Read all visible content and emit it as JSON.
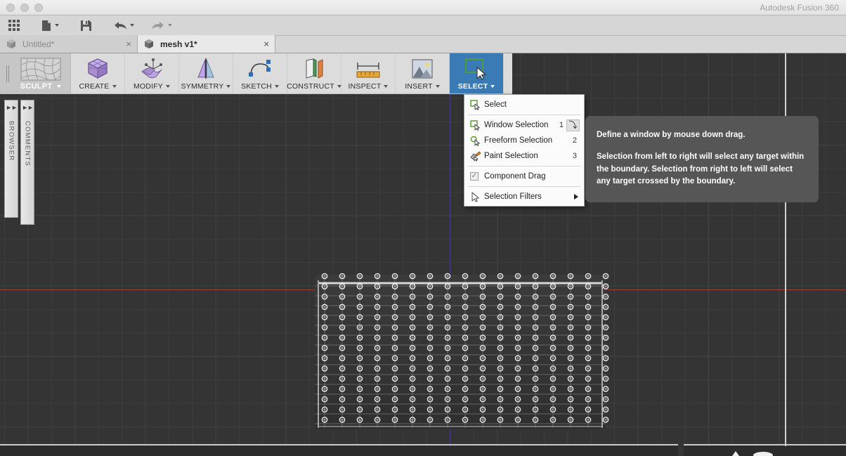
{
  "window": {
    "app_title": "Autodesk Fusion 360",
    "traffic_lights": [
      "close",
      "minimize",
      "zoom"
    ]
  },
  "quick_access": {
    "items": [
      {
        "name": "app-grid",
        "icon": "grid-icon",
        "has_caret": false
      },
      {
        "name": "new-file",
        "icon": "file-icon",
        "has_caret": true
      },
      {
        "name": "save",
        "icon": "save-icon",
        "has_caret": false
      },
      {
        "name": "undo",
        "icon": "undo-arrow-icon",
        "has_caret": true
      },
      {
        "name": "redo",
        "icon": "redo-arrow-icon",
        "has_caret": true
      }
    ]
  },
  "document_tabs": [
    {
      "label": "Untitled*",
      "active": false,
      "icon": "cube-icon",
      "close": "×"
    },
    {
      "label": "mesh v1*",
      "active": true,
      "icon": "cube-icon",
      "close": "×"
    }
  ],
  "ribbon": {
    "workspace": {
      "label": "SCULPT",
      "icon": "mesh-wireframe-icon",
      "caret": "▾"
    },
    "tabs": [
      {
        "label": "CREATE",
        "icon": "rounded-cube-icon",
        "caret": "▾",
        "active": false
      },
      {
        "label": "MODIFY",
        "icon": "surface-manipulate-icon",
        "caret": "▾",
        "active": false
      },
      {
        "label": "SYMMETRY",
        "icon": "mirror-planes-icon",
        "caret": "▾",
        "active": false
      },
      {
        "label": "SKETCH",
        "icon": "spline-curve-icon",
        "caret": "▾",
        "active": false
      },
      {
        "label": "CONSTRUCT",
        "icon": "construction-planes-icon",
        "caret": "▾",
        "active": false
      },
      {
        "label": "INSPECT",
        "icon": "ruler-measure-icon",
        "caret": "▾",
        "active": false
      },
      {
        "label": "INSERT",
        "icon": "image-mountain-icon",
        "caret": "▾",
        "active": false
      },
      {
        "label": "SELECT",
        "icon": "selection-square-cursor-icon",
        "caret": "▾",
        "active": true
      }
    ]
  },
  "dock_panels": [
    {
      "label": "BROWSER",
      "expand_icon": "double-chevron-right-icon"
    },
    {
      "label": "COMMENTS",
      "expand_icon": "double-chevron-right-icon"
    }
  ],
  "select_menu": {
    "items": [
      {
        "type": "item",
        "label": "Select",
        "icon": "select-square-cursor-icon",
        "shortcut": "",
        "badge": ""
      },
      {
        "type": "divider"
      },
      {
        "type": "item",
        "label": "Window Selection",
        "icon": "window-square-cursor-icon",
        "shortcut": "1",
        "badge": "⤵"
      },
      {
        "type": "item",
        "label": "Freeform Selection",
        "icon": "freeform-lasso-cursor-icon",
        "shortcut": "2",
        "badge": ""
      },
      {
        "type": "item",
        "label": "Paint Selection",
        "icon": "paint-brush-cursor-icon",
        "shortcut": "3",
        "badge": ""
      },
      {
        "type": "divider"
      },
      {
        "type": "checkbox",
        "label": "Component Drag",
        "checked": true,
        "check_glyph": "✓"
      },
      {
        "type": "divider"
      },
      {
        "type": "submenu",
        "label": "Selection Filters",
        "icon": "arrow-cursor-icon",
        "arrow": "▶"
      }
    ]
  },
  "tooltip": {
    "paragraphs": [
      "Define a window by mouse down drag.",
      "Selection from left to right will select any target within the boundary. Selection from right to left will select any target crossed by the boundary."
    ]
  },
  "viewport": {
    "object_name": "t-spline-mesh-plane",
    "mesh": {
      "columns": 17,
      "rows": 15,
      "selected": true
    },
    "axes": {
      "x_axis_color": "#9e4040",
      "y_axis_color": "#3b3b86"
    },
    "grid_visible": true,
    "background_color": "#343434"
  },
  "colors": {
    "accent_select": "#3a7ab5",
    "icon_green": "#5a9e33",
    "titlebar_bg": "#e9e9e9",
    "toolbar_bg": "#d6d6d6",
    "ribbon_bg": "#dcdcdc",
    "tooltip_bg": "#565656"
  }
}
